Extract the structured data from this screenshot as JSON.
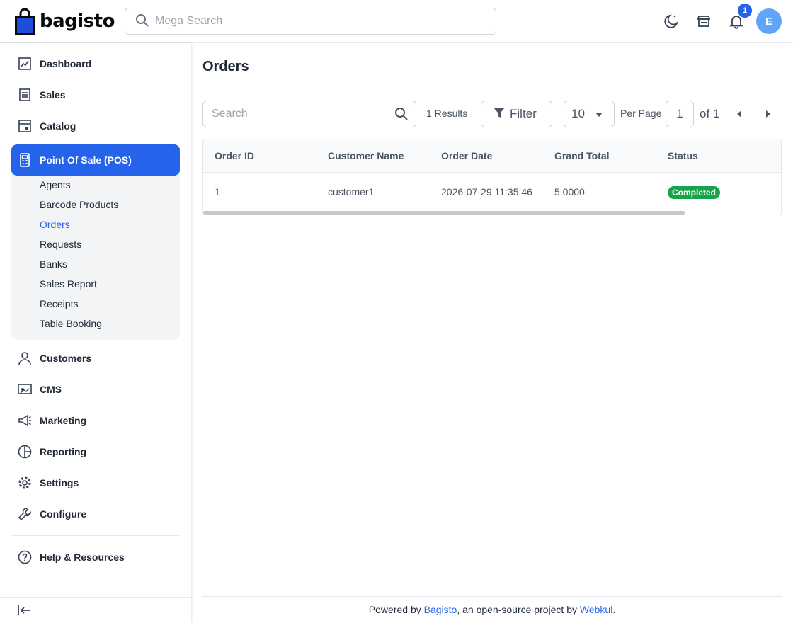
{
  "header": {
    "brand": "bagisto",
    "search_placeholder": "Mega Search",
    "notification_count": "1",
    "avatar_initial": "E"
  },
  "sidebar": {
    "items": [
      {
        "label": "Dashboard",
        "icon": "dashboard-icon"
      },
      {
        "label": "Sales",
        "icon": "sales-icon"
      },
      {
        "label": "Catalog",
        "icon": "catalog-icon"
      },
      {
        "label": "Point Of Sale (POS)",
        "icon": "pos-icon"
      },
      {
        "label": "Customers",
        "icon": "customers-icon"
      },
      {
        "label": "CMS",
        "icon": "cms-icon"
      },
      {
        "label": "Marketing",
        "icon": "marketing-icon"
      },
      {
        "label": "Reporting",
        "icon": "reporting-icon"
      },
      {
        "label": "Settings",
        "icon": "settings-icon"
      },
      {
        "label": "Configure",
        "icon": "configure-icon"
      },
      {
        "label": "Help & Resources",
        "icon": "help-icon"
      }
    ],
    "pos_submenu": [
      "Agents",
      "Barcode Products",
      "Orders",
      "Requests",
      "Banks",
      "Sales Report",
      "Receipts",
      "Table Booking"
    ],
    "active_submenu": "Orders"
  },
  "main": {
    "title": "Orders",
    "search_placeholder": "Search",
    "results": "1 Results",
    "filter_label": "Filter",
    "per_page_value": "10",
    "per_page_label": "Per Page",
    "page_current": "1",
    "page_of": "of 1",
    "table": {
      "columns": [
        "Order ID",
        "Customer Name",
        "Order Date",
        "Grand Total",
        "Status"
      ],
      "rows": [
        {
          "order_id": "1",
          "customer_name": "customer1",
          "order_date": "2026-07-29 11:35:46",
          "grand_total": "5.0000",
          "status": "Completed"
        }
      ]
    }
  },
  "footer": {
    "prefix": "Powered by ",
    "link1": "Bagisto",
    "middle": ", an open-source project by ",
    "link2": "Webkul",
    "suffix": "."
  },
  "colors": {
    "accent": "#2563eb",
    "status_completed": "#16a34a",
    "avatar": "#60a5fa"
  }
}
